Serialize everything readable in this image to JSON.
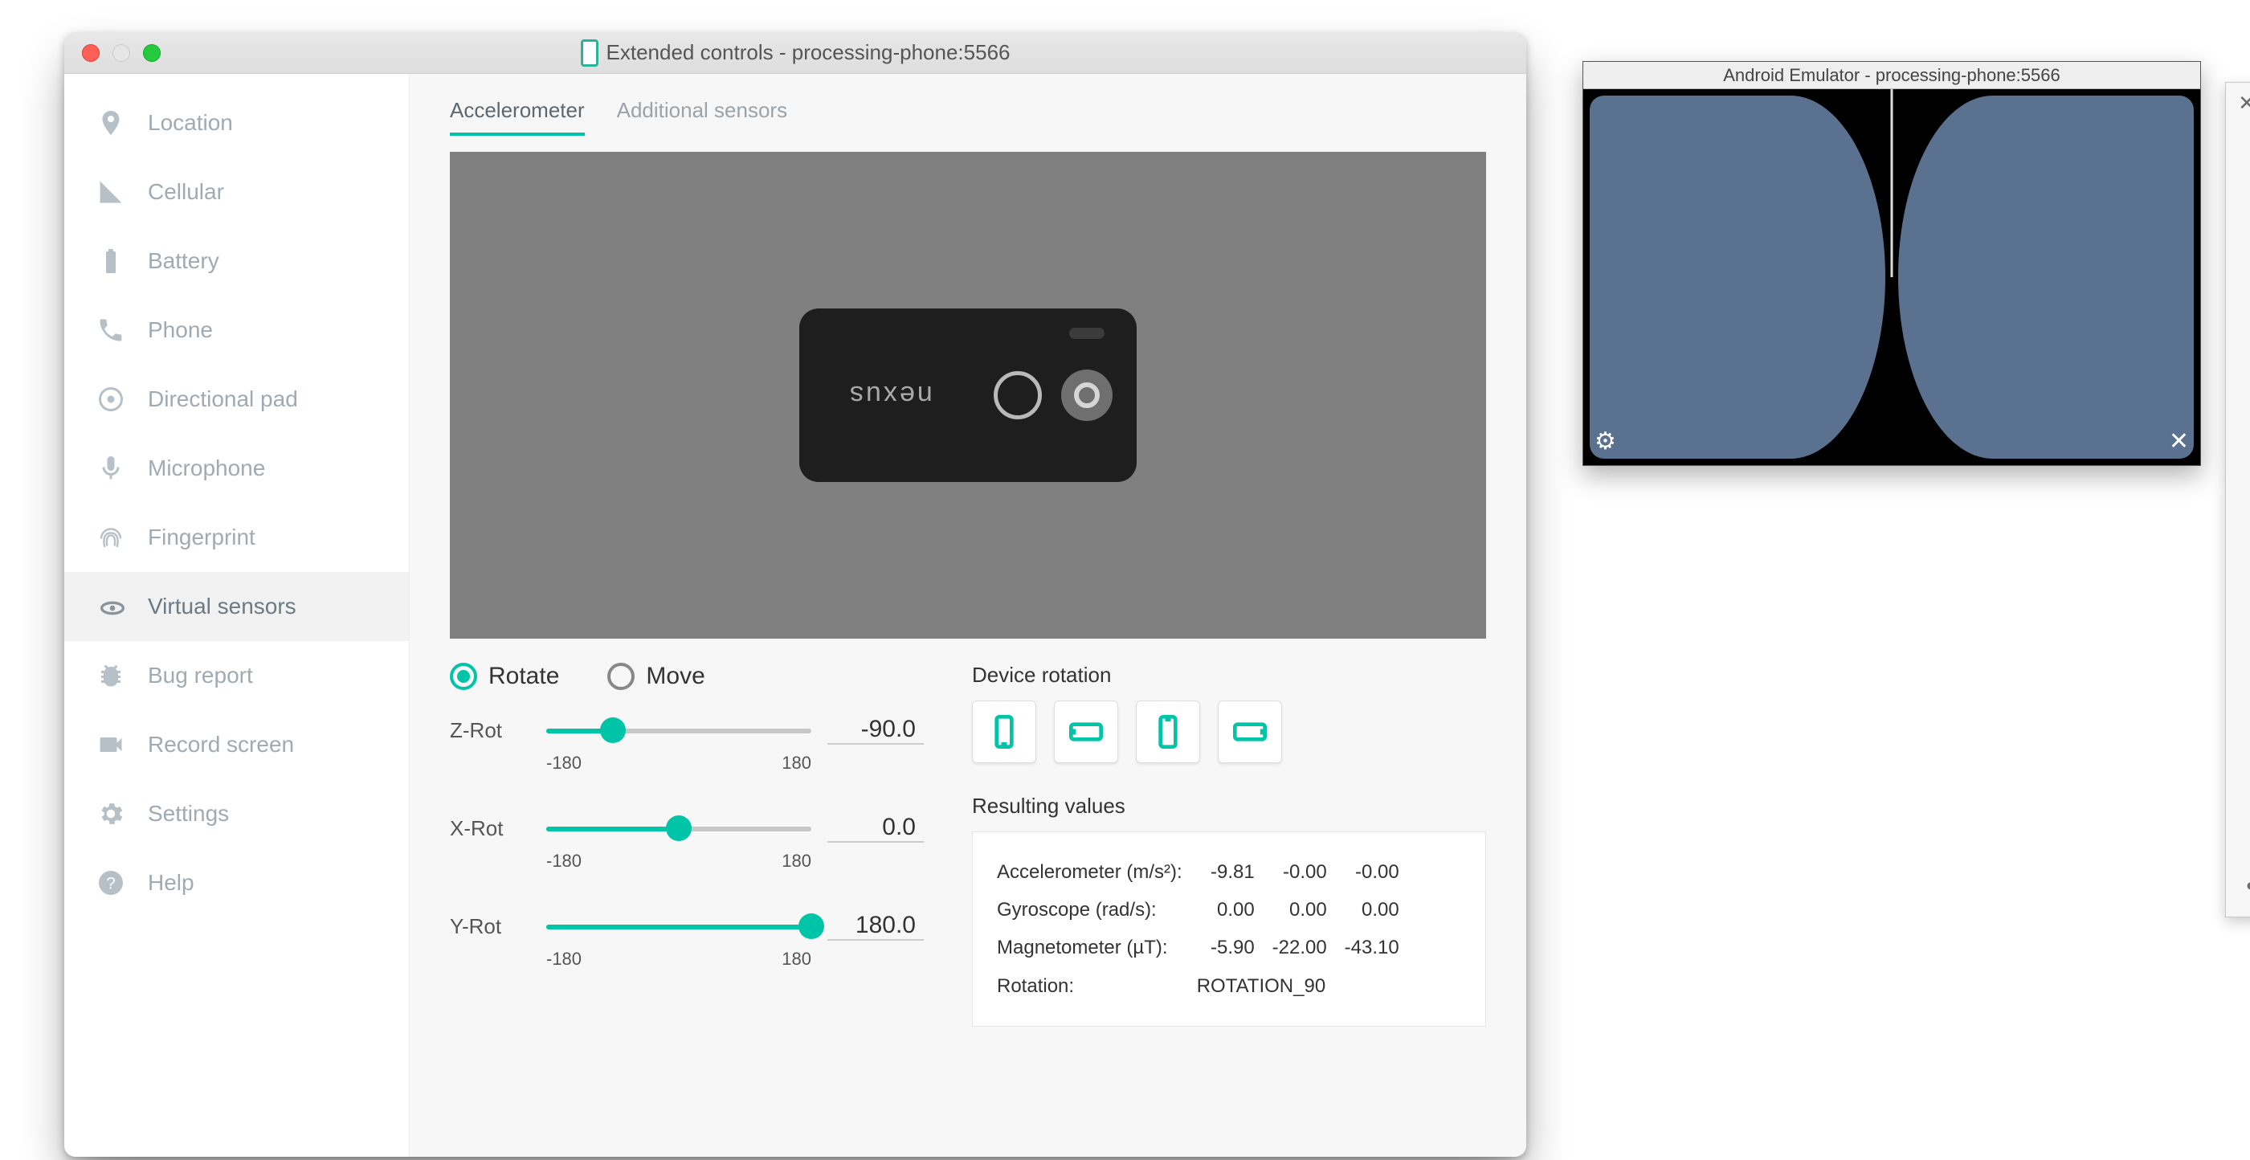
{
  "ext_window": {
    "title": "Extended controls - processing-phone:5566"
  },
  "sidebar": {
    "items": [
      {
        "label": "Location"
      },
      {
        "label": "Cellular"
      },
      {
        "label": "Battery"
      },
      {
        "label": "Phone"
      },
      {
        "label": "Directional pad"
      },
      {
        "label": "Microphone"
      },
      {
        "label": "Fingerprint"
      },
      {
        "label": "Virtual sensors"
      },
      {
        "label": "Bug report"
      },
      {
        "label": "Record screen"
      },
      {
        "label": "Settings"
      },
      {
        "label": "Help"
      }
    ],
    "selected_index": 7
  },
  "tabs": {
    "items": [
      "Accelerometer",
      "Additional sensors"
    ],
    "active_index": 0
  },
  "preview": {
    "phone_brand": "nexus"
  },
  "mode": {
    "rotate_label": "Rotate",
    "move_label": "Move",
    "selected": "rotate"
  },
  "sliders": {
    "z": {
      "label": "Z-Rot",
      "min": "-180",
      "max": "180",
      "value": "-90.0",
      "pct": 25
    },
    "x": {
      "label": "X-Rot",
      "min": "-180",
      "max": "180",
      "value": "0.0",
      "pct": 50
    },
    "y": {
      "label": "Y-Rot",
      "min": "-180",
      "max": "180",
      "value": "180.0",
      "pct": 100
    }
  },
  "rotation": {
    "section_label": "Device rotation"
  },
  "results": {
    "section_label": "Resulting values",
    "rows": {
      "accel": {
        "label": "Accelerometer (m/s²):",
        "v1": "-9.81",
        "v2": "-0.00",
        "v3": "-0.00"
      },
      "gyro": {
        "label": "Gyroscope (rad/s):",
        "v1": "0.00",
        "v2": "0.00",
        "v3": "0.00"
      },
      "mag": {
        "label": "Magnetometer (µT):",
        "v1": "-5.90",
        "v2": "-22.00",
        "v3": "-43.10"
      },
      "rot": {
        "label": "Rotation:",
        "value": "ROTATION_90"
      }
    }
  },
  "emulator": {
    "title": "Android Emulator - processing-phone:5566"
  }
}
